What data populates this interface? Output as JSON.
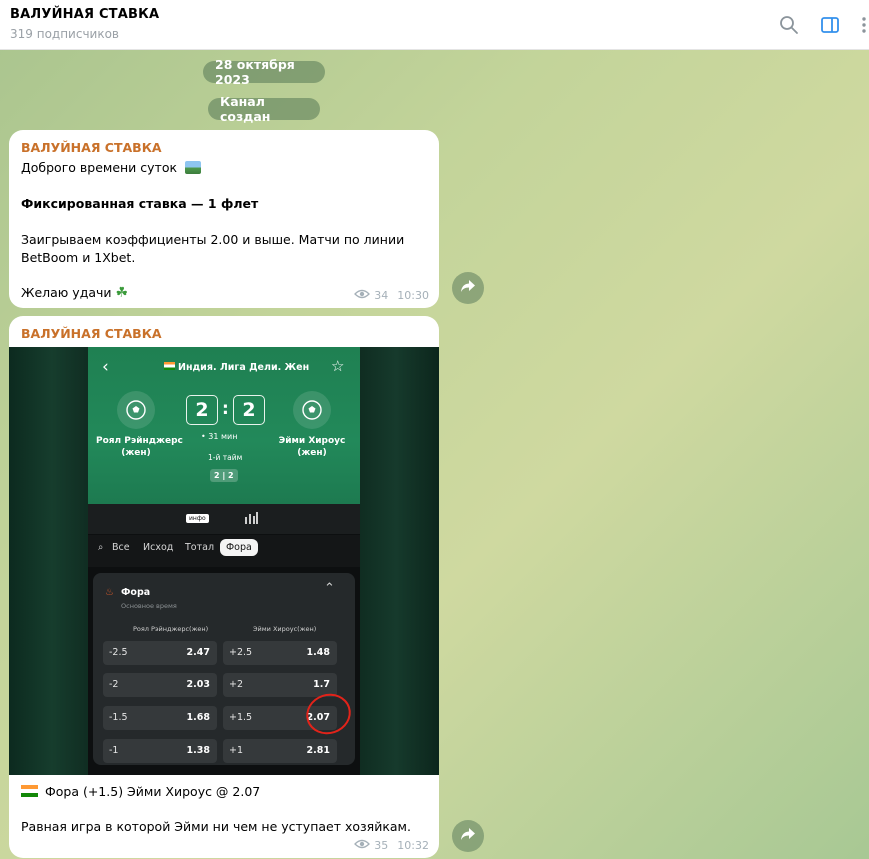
{
  "header": {
    "title": "ВАЛУЙНАЯ СТАВКА",
    "subscribers": "319 подписчиков",
    "icons": [
      "search-icon",
      "sidebar-toggle-icon",
      "more-vertical-icon"
    ]
  },
  "service": {
    "date": "28 октября 2023",
    "created": "Канал создан"
  },
  "msg1": {
    "author": "ВАЛУЙНАЯ СТАВКА",
    "line1": "Доброго времени суток",
    "line2": "Фиксированная ставка — 1 флет",
    "line3": "Заигрываем коэффициенты 2.00 и выше. Матчи по линии",
    "line4": "BetBoom и 1Xbet.",
    "line5": "Желаю удачи",
    "views": "34",
    "time": "10:30",
    "emoji1": "landscape-picture-emoji",
    "emoji2": "shamrock-emoji"
  },
  "msg2": {
    "author": "ВАЛУЙНАЯ СТАВКА",
    "caption1": "Фора (+1.5) Эйми Хироус @ 2.07",
    "caption2": "Равная игра в которой Эйми ни чем не уступает хозяйкам.",
    "views": "35",
    "time": "10:32",
    "flag": "india-flag-emoji"
  },
  "screenshot": {
    "league": "Индия. Лига Дели. Жен",
    "team1": "Роял Рэйнджерс (жен)",
    "team1_line1": "Роял Рэйнджерс",
    "team1_line2": "(жен)",
    "team2_line1": "Эйми Хироус",
    "team2_line2": "(жен)",
    "score1": "2",
    "score_sep": ":",
    "score2": "2",
    "minute": "31 мин",
    "half": "1-й тайм",
    "half_score": "2 | 2",
    "nav_label": "инфо",
    "tabs": [
      "Все",
      "Исход",
      "Тотал",
      "Фора"
    ],
    "market_title": "Фора",
    "market_sub": "Основное время",
    "col1": "Роял Рэйнджерс(жен)",
    "col2": "Эйми Хироус(жен)",
    "rows": [
      {
        "h1": "-2.5",
        "o1": "2.47",
        "h2": "+2.5",
        "o2": "1.48"
      },
      {
        "h1": "-2",
        "o1": "2.03",
        "h2": "+2",
        "o2": "1.7"
      },
      {
        "h1": "-1.5",
        "o1": "1.68",
        "h2": "+1.5",
        "o2": "2.07"
      },
      {
        "h1": "-1",
        "o1": "1.38",
        "h2": "+1",
        "o2": "2.81"
      }
    ],
    "accent": "#22895a",
    "highlight": "#e2231a"
  },
  "colors": {
    "author": "#c9712a",
    "meta": "#a5b0b8",
    "header_icon_active": "#3390ec"
  }
}
